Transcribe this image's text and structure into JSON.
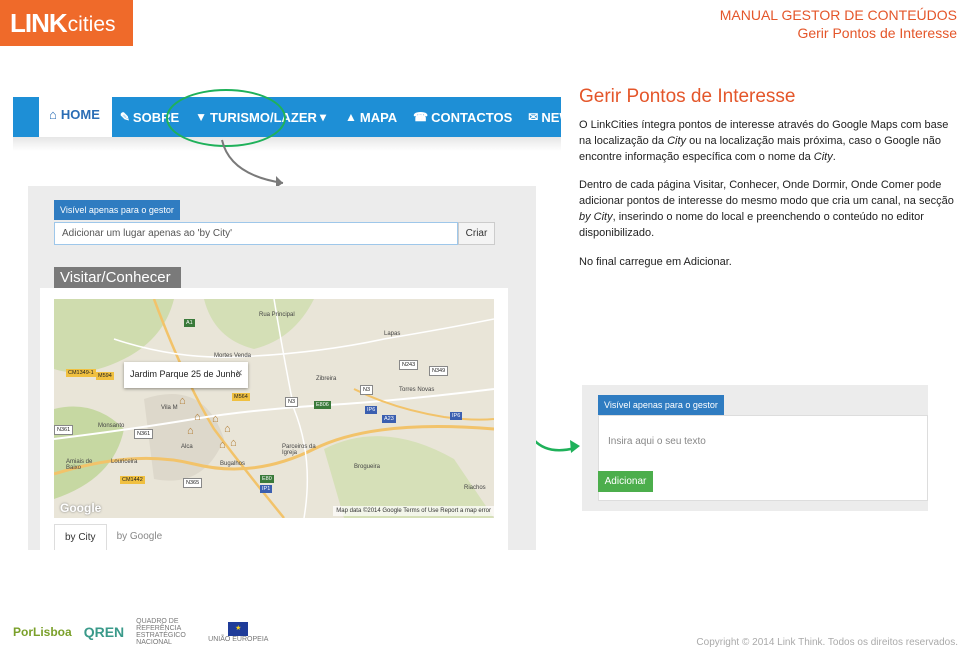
{
  "header": {
    "logo_main": "LINK",
    "logo_sub": "cities",
    "title": "MANUAL GESTOR DE CONTEÚDOS",
    "subtitle": "Gerir Pontos de Interesse"
  },
  "navbar": {
    "home": "HOME",
    "sobre": "SOBRE",
    "turismo": "TURISMO/LAZER",
    "mapa": "MAPA",
    "contactos": "CONTACTOS",
    "newsletter": "NEWSLETTER"
  },
  "panel1": {
    "visible_badge": "Visível apenas para o gestor",
    "add_placeholder": "Adicionar um lugar apenas ao 'by City'",
    "criar": "Criar",
    "section_title": "Visitar/Conhecer",
    "popup_title": "Jardim Parque 25 de Junho",
    "popup_close": "✕",
    "google_logo": "Google",
    "map_footer": "Map data ©2014 Google   Terms of Use   Report a map error",
    "tabs": [
      "by City",
      "by Google"
    ]
  },
  "map_labels": {
    "a1": "A1",
    "rua_principal": "Rua Principal",
    "lapas": "Lapas",
    "cm349": "CM1349-1",
    "m594": "M594",
    "mortes_venda": "Mortes Venda",
    "zibreira": "Zibreira",
    "n243": "N243",
    "torres_novas": "Torres Novas",
    "n349": "N349",
    "m564": "M564",
    "n3": "N3",
    "e806": "E806",
    "n3b": "N3",
    "ip6": "IP6",
    "a23": "A23",
    "ip6b": "IP6",
    "vila": "Vila M",
    "n361": "N361",
    "monsanto": "Monsanto",
    "n361b": "N361",
    "parceiros": "Parceiros da Igreja",
    "amiais": "Amiais de Baixo",
    "louriceira": "Louriceira",
    "bugalhos": "Bugalhos",
    "brogueira": "Brogueira",
    "alcanena": "Alca",
    "riachos": "Riachos",
    "cm442": "CM1442",
    "n365": "N365",
    "e80": "E80",
    "ip1": "IP1"
  },
  "content": {
    "title": "Gerir Pontos de Interesse",
    "p1_a": "O LinkCities íntegra pontos de interesse através do Google Maps com base na localização da ",
    "p1_city1": "City",
    "p1_b": " ou na localização mais próxima, caso o Google não encontre informação específica com o nome da ",
    "p1_city2": "City",
    "p1_c": ".",
    "p2_a": "Dentro de cada página Visitar, Conhecer, Onde Dormir,  Onde Comer pode adicionar pontos de interesse do mesmo modo que cria um canal, na secção ",
    "p2_bycity": "by City",
    "p2_b": ", inserindo o nome do local e preenchendo o conteúdo no editor disponibilizado.",
    "p3": "No final carregue em Adicionar."
  },
  "panel2": {
    "visible_badge": "Visível apenas para o gestor",
    "placeholder": "Insira aqui o seu texto",
    "adicionar": "Adicionar"
  },
  "footer": {
    "por": "PorLisboa",
    "qren": "QREN",
    "qren_text": "QUADRO DE REFERÊNCIA ESTRATÉGICO NACIONAL",
    "eu_text": "UNIÃO EUROPEIA",
    "copyright": "Copyright © 2014 Link Think. Todos os direitos reservados."
  },
  "colors": {
    "brand_orange": "#ef6a2a",
    "nav_blue": "#1e8fd6",
    "annotation_green": "#1fb15a",
    "button_green": "#4cae4c"
  }
}
